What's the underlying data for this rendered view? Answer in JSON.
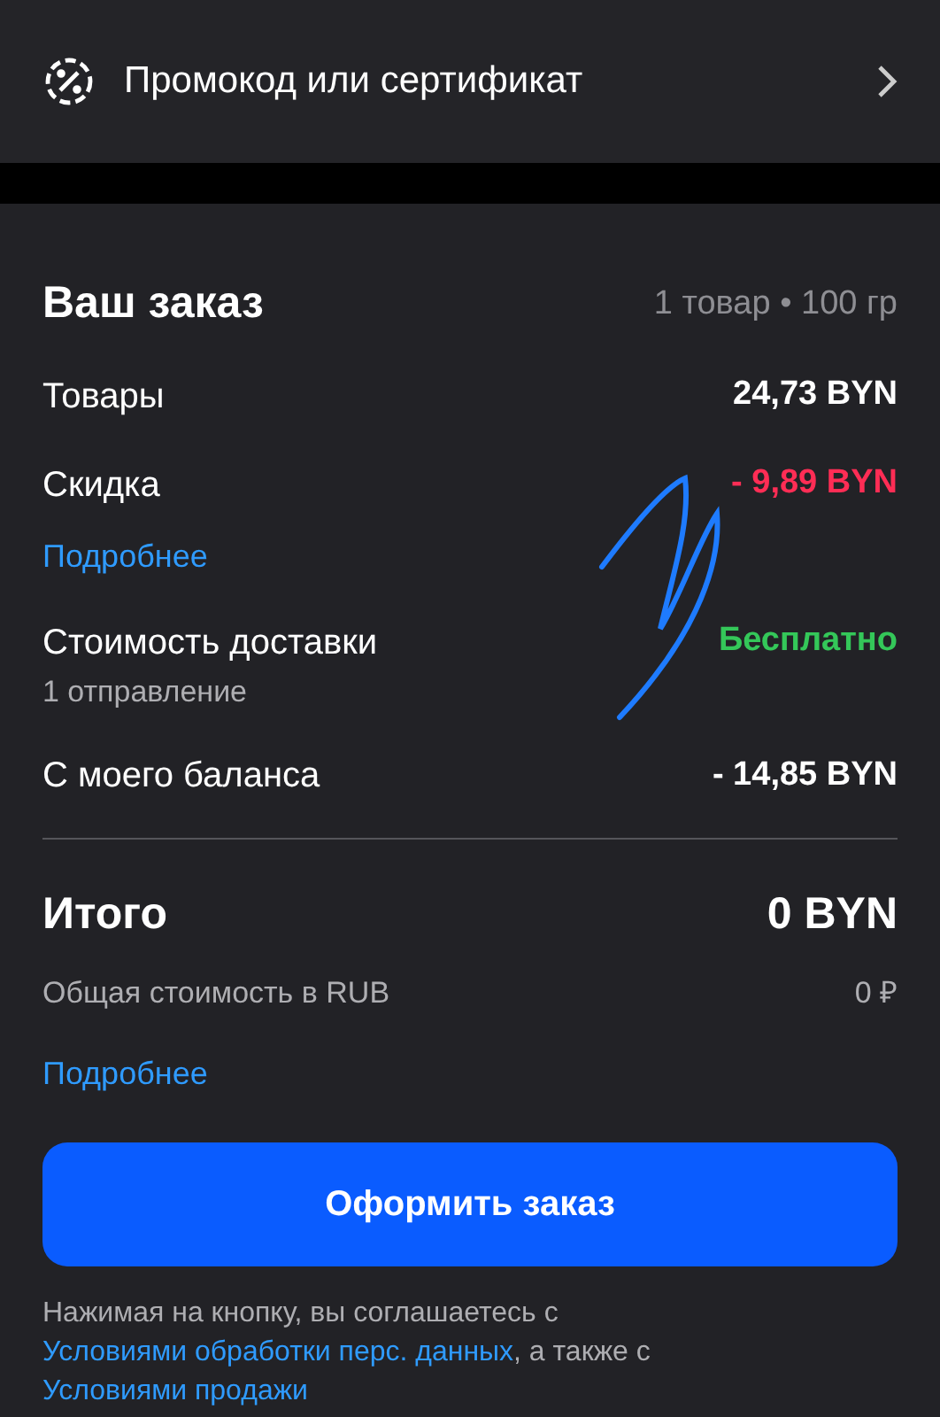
{
  "promo": {
    "label": "Промокод или сертификат"
  },
  "order": {
    "title": "Ваш заказ",
    "summary": "1 товар • 100 гр"
  },
  "lines": [
    {
      "kind": "normal",
      "label": "Товары",
      "value": "24,73 BYN"
    },
    {
      "kind": "discount",
      "label": "Скидка",
      "value": "- 9,89 BYN",
      "link": "Подробнее"
    },
    {
      "kind": "free",
      "label": "Стоимость доставки",
      "sublabel": "1 отправление",
      "value": "Бесплатно"
    },
    {
      "kind": "normal",
      "label": "С моего баланса",
      "value": "- 14,85 BYN"
    }
  ],
  "total": {
    "label": "Итого",
    "value": "0 BYN",
    "rub_label": "Общая стоимость в RUB",
    "rub_value": "0 ₽",
    "link": "Подробнее"
  },
  "button": "Оформить заказ",
  "legal": [
    {
      "kind": "text",
      "text": "Нажимая на кнопку, вы соглашаетесь с "
    },
    {
      "kind": "link",
      "text": "Условиями обработки перс. данных"
    },
    {
      "kind": "text",
      "text": ", а также с "
    },
    {
      "kind": "link",
      "text": "Условиями продажи"
    }
  ]
}
